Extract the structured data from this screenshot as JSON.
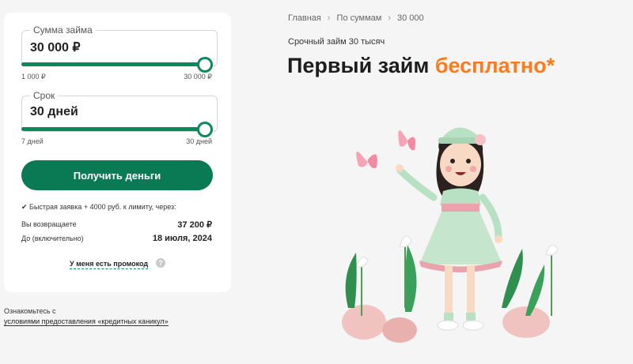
{
  "calculator": {
    "amount": {
      "label": "Сумма займа",
      "value": "30 000 ₽",
      "min_label": "1 000 ₽",
      "max_label": "30 000 ₽",
      "level_fraction": 1.0
    },
    "term": {
      "label": "Срок",
      "value": "30 дней",
      "min_label": "7 дней",
      "max_label": "30 дней",
      "level_fraction": 1.0
    },
    "cta_label": "Получить деньги",
    "fast_note": "✔ Быстрая заявка + 4000 руб. к лимиту, через:",
    "repay_label": "Вы возвращаете",
    "repay_value": "37 200 ₽",
    "until_label": "До (включительно)",
    "until_value": "18 июля, 2024",
    "promo_label": "У меня есть промокод",
    "help_glyph": "?"
  },
  "note": {
    "line1": "Ознакомьтесь с",
    "link": "условиями предоставления «кредитных каникул»"
  },
  "breadcrumb": {
    "items": [
      "Главная",
      "По суммам",
      "30 000"
    ],
    "separator": "›"
  },
  "hero": {
    "subtitle": "Срочный займ 30 тысяч",
    "title_main": "Первый займ ",
    "title_accent": "бесплатно*"
  },
  "colors": {
    "brand_green": "#0a7a55",
    "accent_orange": "#ff7a1a",
    "background": "#f5f5f6"
  }
}
